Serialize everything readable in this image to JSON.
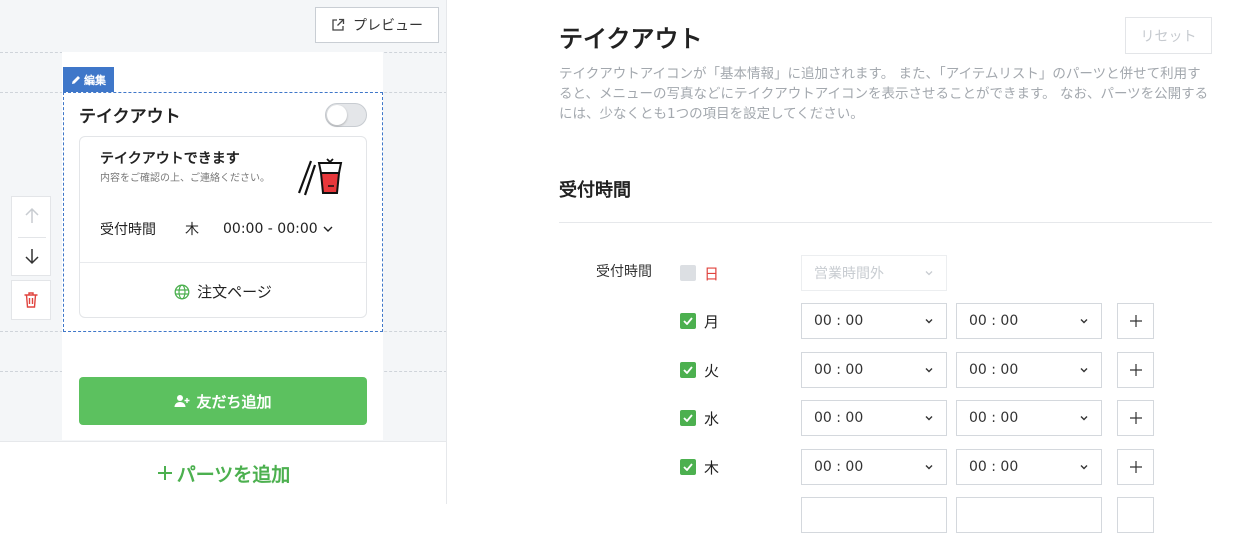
{
  "preview": {
    "label": "プレビュー"
  },
  "editor": {
    "edit_tag": "編集",
    "part_title": "テイクアウト",
    "toggle_on": false,
    "card": {
      "title": "テイクアウトできます",
      "description": "内容をご確認の上、ご連絡ください。",
      "hours_label": "受付時間",
      "day": "木",
      "time": "00:00 - 00:00",
      "order_page": "注文ページ"
    },
    "friend_button": "友だち追加",
    "add_parts": "パーツを追加"
  },
  "settings": {
    "title": "テイクアウト",
    "reset": "リセット",
    "description": "テイクアウトアイコンが「基本情報」に追加されます。 また、「アイテムリスト」のパーツと併せて利用すると、メニューの写真などにテイクアウトアイコンを表示させることができます。 なお、パーツを公開するには、少なくとも1つの項目を設定してください。",
    "section_title": "受付時間",
    "hours_label": "受付時間",
    "days": [
      {
        "name": "日",
        "checked": false,
        "closed_label": "営業時間外"
      },
      {
        "name": "月",
        "checked": true,
        "start": "00 : 00",
        "end": "00 : 00"
      },
      {
        "name": "火",
        "checked": true,
        "start": "00 : 00",
        "end": "00 : 00"
      },
      {
        "name": "水",
        "checked": true,
        "start": "00 : 00",
        "end": "00 : 00"
      },
      {
        "name": "木",
        "checked": true,
        "start": "00 : 00",
        "end": "00 : 00"
      }
    ]
  },
  "colors": {
    "accent_green": "#4cb04f",
    "edit_blue": "#3f77c9",
    "sunday_red": "#e0433e",
    "trash_red": "#e0433e"
  }
}
